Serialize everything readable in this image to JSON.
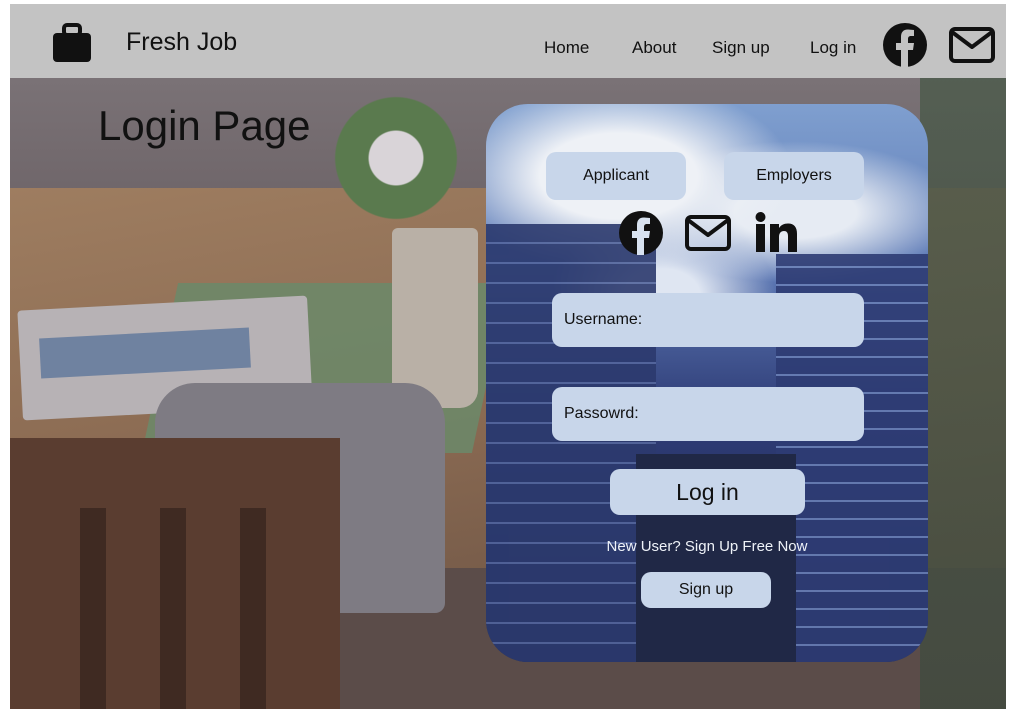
{
  "header": {
    "brand_name": "Fresh Job",
    "nav": {
      "home": "Home",
      "about": "About",
      "signup": "Sign up",
      "login": "Log in"
    }
  },
  "page": {
    "title": "Login Page"
  },
  "login_card": {
    "roles": {
      "applicant": "Applicant",
      "employers": "Employers"
    },
    "fields": {
      "username_label": "Username:",
      "password_label": "Passowrd:"
    },
    "login_button": "Log in",
    "new_user_text": "New User? Sign Up Free Now",
    "signup_button": "Sign up"
  },
  "colors": {
    "navbar": "#c3c3c3",
    "button_fill": "#c8d6ea",
    "text": "#111111"
  },
  "icons": [
    "briefcase-icon",
    "facebook-icon",
    "mail-icon",
    "linkedin-icon"
  ]
}
